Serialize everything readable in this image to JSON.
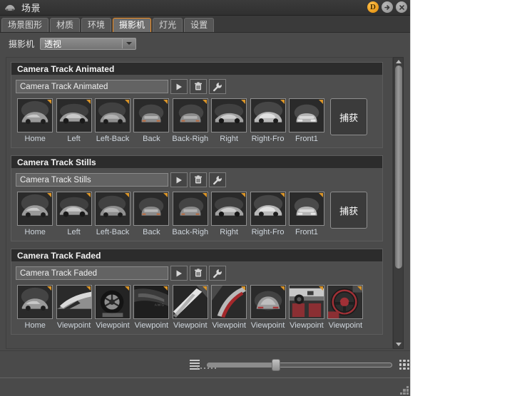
{
  "window": {
    "title": "场景",
    "icon": "scene-icon",
    "buttons": [
      {
        "name": "dongle-button",
        "label": "D"
      },
      {
        "name": "detach-button",
        "label": "→"
      },
      {
        "name": "close-button",
        "label": "✕"
      }
    ]
  },
  "tabs": [
    {
      "label": "场景图形",
      "name": "tab-scene-graph",
      "active": false
    },
    {
      "label": "材质",
      "name": "tab-materials",
      "active": false
    },
    {
      "label": "环境",
      "name": "tab-environment",
      "active": false
    },
    {
      "label": "摄影机",
      "name": "tab-cameras",
      "active": true
    },
    {
      "label": "灯光",
      "name": "tab-lights",
      "active": false
    },
    {
      "label": "设置",
      "name": "tab-settings",
      "active": false
    }
  ],
  "camera_selector": {
    "label": "摄影机",
    "value": "透视"
  },
  "capture_label": "捕获",
  "groups": [
    {
      "title": "Camera Track Animated",
      "name_value": "Camera Track Animated",
      "buttons": [
        "play-button",
        "delete-button",
        "settings-button"
      ],
      "thumbs": [
        {
          "label": "Home",
          "view": "front-quarter-left"
        },
        {
          "label": "Left",
          "view": "side-left"
        },
        {
          "label": "Left-Back",
          "view": "rear-quarter-left"
        },
        {
          "label": "Back",
          "view": "rear"
        },
        {
          "label": "Back-Righ",
          "view": "rear-quarter-right"
        },
        {
          "label": "Right",
          "view": "side-right"
        },
        {
          "label": "Right-Fro",
          "view": "front-quarter-right"
        },
        {
          "label": "Front1",
          "view": "front"
        }
      ]
    },
    {
      "title": "Camera Track Stills",
      "name_value": "Camera Track Stills",
      "buttons": [
        "play-button",
        "delete-button",
        "settings-button"
      ],
      "thumbs": [
        {
          "label": "Home",
          "view": "front-quarter-left"
        },
        {
          "label": "Left",
          "view": "side-left"
        },
        {
          "label": "Left-Back",
          "view": "rear-quarter-left"
        },
        {
          "label": "Back",
          "view": "rear"
        },
        {
          "label": "Back-Righ",
          "view": "rear-quarter-right"
        },
        {
          "label": "Right",
          "view": "side-right"
        },
        {
          "label": "Right-Fro",
          "view": "front-quarter-right"
        },
        {
          "label": "Front1",
          "view": "front"
        }
      ]
    },
    {
      "title": "Camera Track Faded",
      "name_value": "Camera Track Faded",
      "buttons": [
        "play-button",
        "delete-button",
        "settings-button"
      ],
      "thumbs": [
        {
          "label": "Home",
          "view": "front-quarter-left"
        },
        {
          "label": "Viewpoint",
          "view": "hood-detail"
        },
        {
          "label": "Viewpoint",
          "view": "wheel-detail"
        },
        {
          "label": "Viewpoint",
          "view": "dark-panel"
        },
        {
          "label": "Viewpoint",
          "view": "light-streak"
        },
        {
          "label": "Viewpoint",
          "view": "red-accent"
        },
        {
          "label": "Viewpoint",
          "view": "rear-top"
        },
        {
          "label": "Viewpoint",
          "view": "interior-dash"
        },
        {
          "label": "Viewpoint",
          "view": "steering-wheel"
        }
      ]
    }
  ],
  "zoom_bar": {
    "list_icon": "list-view-icon",
    "grid_icon": "grid-view-icon",
    "slider_value": 37
  },
  "colors": {
    "accent": "#f08a1c",
    "panel": "#4a4a4a",
    "header": "#2c2c2c",
    "thumb_marker": "#d99428"
  }
}
